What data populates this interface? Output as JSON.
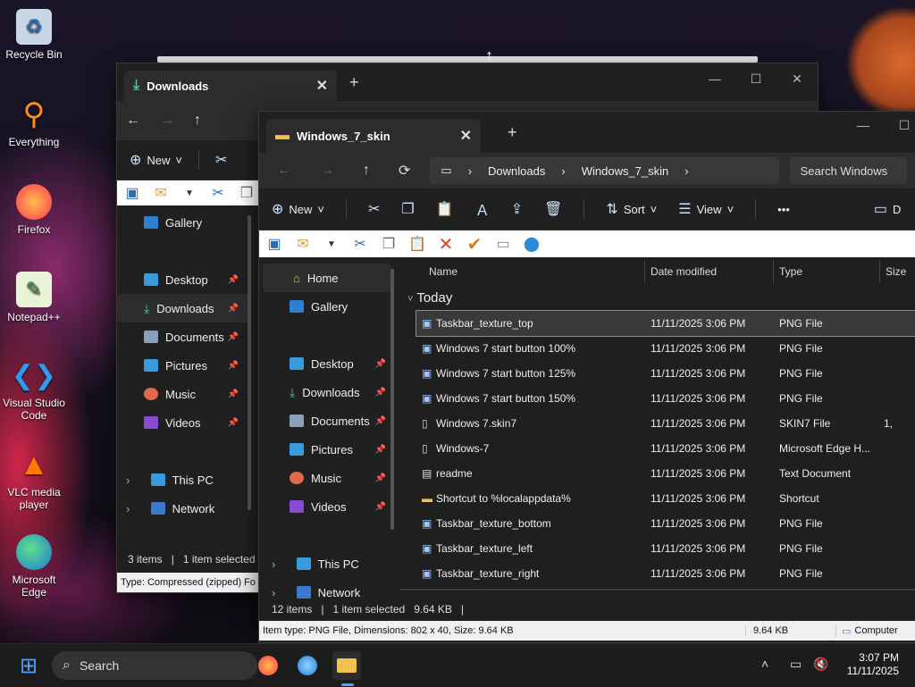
{
  "desktop": {
    "icons": [
      {
        "label": "Recycle Bin",
        "icon": "recycle-bin-icon"
      },
      {
        "label": "Everything",
        "icon": "everything-icon"
      },
      {
        "label": "Firefox",
        "icon": "firefox-icon"
      },
      {
        "label": "Notepad++",
        "icon": "notepadpp-icon"
      },
      {
        "label": "Visual Studio Code",
        "icon": "vscode-icon"
      },
      {
        "label": "VLC media player",
        "icon": "vlc-icon"
      },
      {
        "label": "Microsoft Edge",
        "icon": "edge-icon"
      }
    ]
  },
  "back_window": {
    "tab_title": "Downloads",
    "new_label": "New",
    "sidebar": [
      {
        "label": "Gallery"
      },
      {
        "label": "Desktop",
        "pinned": true
      },
      {
        "label": "Downloads",
        "pinned": true,
        "selected": true
      },
      {
        "label": "Documents",
        "pinned": true
      },
      {
        "label": "Pictures",
        "pinned": true
      },
      {
        "label": "Music",
        "pinned": true
      },
      {
        "label": "Videos",
        "pinned": true
      },
      {
        "label": "This PC"
      },
      {
        "label": "Network"
      }
    ],
    "status": {
      "items": "3 items",
      "selected": "1 item selected"
    },
    "classic_status": "Type: Compressed (zipped) Fo"
  },
  "front_window": {
    "tab_title": "Windows_7_skin",
    "breadcrumb": [
      "Downloads",
      "Windows_7_skin"
    ],
    "search_placeholder": "Search Windows",
    "cmd": {
      "new": "New",
      "sort": "Sort",
      "view": "View",
      "details": "D"
    },
    "sidebar": [
      {
        "label": "Home",
        "selected": true
      },
      {
        "label": "Gallery"
      },
      {
        "label": "Desktop",
        "pinned": true
      },
      {
        "label": "Downloads",
        "pinned": true
      },
      {
        "label": "Documents",
        "pinned": true
      },
      {
        "label": "Pictures",
        "pinned": true
      },
      {
        "label": "Music",
        "pinned": true
      },
      {
        "label": "Videos",
        "pinned": true
      },
      {
        "label": "This PC"
      },
      {
        "label": "Network"
      }
    ],
    "columns": {
      "name": "Name",
      "date": "Date modified",
      "type": "Type",
      "size": "Size"
    },
    "group": "Today",
    "files": [
      {
        "name": "Taskbar_texture_top",
        "date": "11/11/2025 3:06 PM",
        "type": "PNG File",
        "size": "",
        "selected": true
      },
      {
        "name": "Windows 7 start button 100%",
        "date": "11/11/2025 3:06 PM",
        "type": "PNG File",
        "size": ""
      },
      {
        "name": "Windows 7 start button 125%",
        "date": "11/11/2025 3:06 PM",
        "type": "PNG File",
        "size": ""
      },
      {
        "name": "Windows 7 start button 150%",
        "date": "11/11/2025 3:06 PM",
        "type": "PNG File",
        "size": ""
      },
      {
        "name": "Windows 7.skin7",
        "date": "11/11/2025 3:06 PM",
        "type": "SKIN7 File",
        "size": "1,"
      },
      {
        "name": "Windows-7",
        "date": "11/11/2025 3:06 PM",
        "type": "Microsoft Edge H...",
        "size": ""
      },
      {
        "name": "readme",
        "date": "11/11/2025 3:06 PM",
        "type": "Text Document",
        "size": ""
      },
      {
        "name": "Shortcut to %localappdata%",
        "date": "11/11/2025 3:06 PM",
        "type": "Shortcut",
        "size": ""
      },
      {
        "name": "Taskbar_texture_bottom",
        "date": "11/11/2025 3:06 PM",
        "type": "PNG File",
        "size": ""
      },
      {
        "name": "Taskbar_texture_left",
        "date": "11/11/2025 3:06 PM",
        "type": "PNG File",
        "size": ""
      },
      {
        "name": "Taskbar_texture_right",
        "date": "11/11/2025 3:06 PM",
        "type": "PNG File",
        "size": ""
      }
    ],
    "status": {
      "items": "12 items",
      "selected": "1 item selected",
      "size": "9.64 KB"
    },
    "classic_status": {
      "info": "Item type: PNG File, Dimensions: 802 x 40, Size: 9.64 KB",
      "size": "9.64 KB",
      "location": "Computer"
    }
  },
  "taskbar": {
    "search": "Search",
    "time": "3:07 PM",
    "date": "11/11/2025"
  },
  "colors": {
    "accent": "#4aa3ff",
    "folder": "#f2c14e"
  }
}
